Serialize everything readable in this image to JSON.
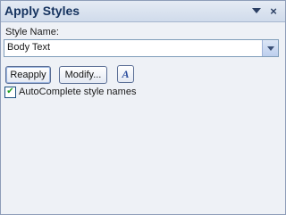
{
  "pane": {
    "title": "Apply Styles",
    "menu_icon": "dropdown-triangle-icon",
    "close_glyph": "×"
  },
  "style_name": {
    "label": "Style Name:",
    "value": "Body Text"
  },
  "buttons": {
    "reapply": "Reapply",
    "modify": "Modify...",
    "inspector_glyph": "A"
  },
  "autocomplete": {
    "checked": true,
    "check_glyph": "✔",
    "label": "AutoComplete style names"
  },
  "colors": {
    "title": "#15325e",
    "pane_background": "#eef1f6",
    "checkmark": "#21a121"
  }
}
